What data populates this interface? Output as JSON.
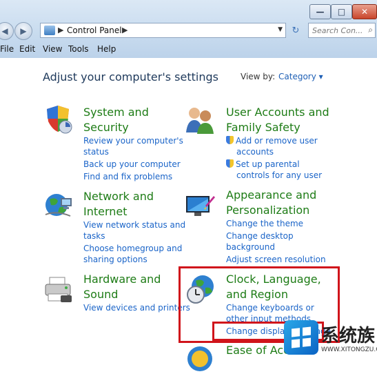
{
  "window": {
    "minimize_glyph": "—",
    "maximize_glyph": "□",
    "close_glyph": "✕"
  },
  "nav": {
    "back_glyph": "◀",
    "forward_glyph": "▶",
    "breadcrumb": "Control Panel",
    "crumb_sep": "▶",
    "dropdown_glyph": "▼",
    "refresh_glyph": "↻",
    "search_placeholder": "Search Con...",
    "search_glyph": "⌕"
  },
  "menu": [
    "File",
    "Edit",
    "View",
    "Tools",
    "Help"
  ],
  "header": {
    "title": "Adjust your computer's settings",
    "view_by_label": "View by:",
    "view_by_value": "Category ▾"
  },
  "categories": {
    "system": {
      "title1": "System and",
      "title2": "Security",
      "links": [
        "Review your computer's",
        "status",
        "Back up your computer",
        "Find and fix problems"
      ]
    },
    "network": {
      "title1": "Network and",
      "title2": "Internet",
      "links": [
        "View network status and",
        "tasks",
        "Choose homegroup and",
        "sharing options"
      ]
    },
    "hardware": {
      "title1": "Hardware and",
      "title2": "Sound",
      "links": [
        "View devices and printers"
      ]
    },
    "users": {
      "title1": "User Accounts and",
      "title2": "Family Safety",
      "links": [
        "Add or remove user",
        "accounts",
        "Set up parental",
        "controls for any user"
      ]
    },
    "appearance": {
      "title1": "Appearance and",
      "title2": "Personalization",
      "links": [
        "Change the theme",
        "Change desktop",
        "background",
        "Adjust screen resolution"
      ]
    },
    "clock": {
      "title1": "Clock, Language,",
      "title2": "and Region",
      "links": [
        "Change keyboards or",
        "other input methods",
        "Change display language"
      ]
    },
    "ease": {
      "title1": "Ease of Access"
    }
  },
  "watermark": {
    "text": "系统族",
    "url": "WWW.XITONGZU.COM"
  },
  "colors": {
    "category_title": "#1e7c16",
    "link": "#1a64c8",
    "highlight": "#d0141b"
  }
}
